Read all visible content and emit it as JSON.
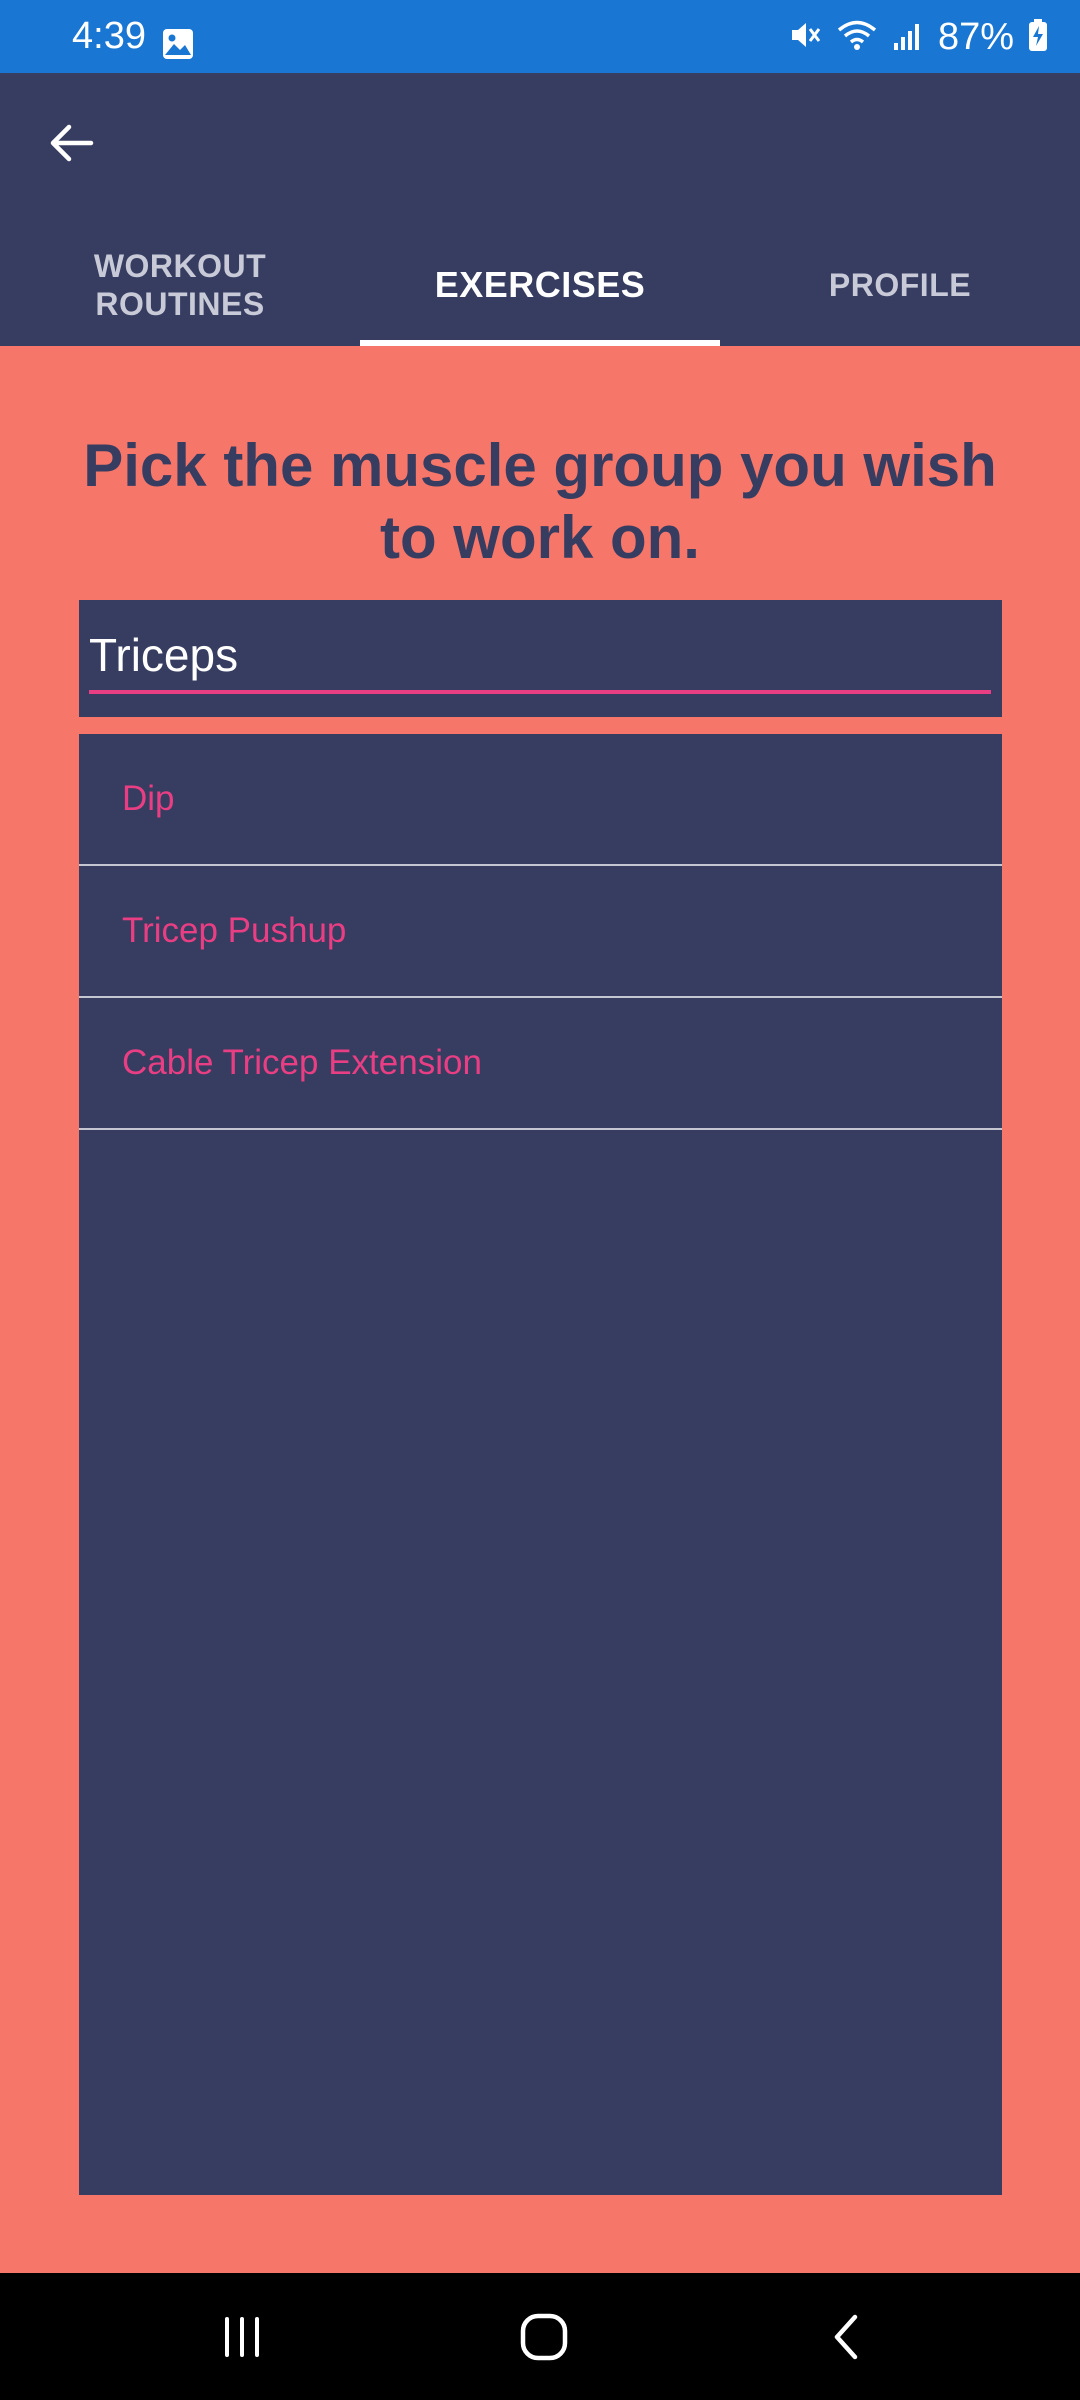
{
  "status_bar": {
    "time": "4:39",
    "battery_percent": "87%",
    "icons": [
      "image-icon",
      "mute-icon",
      "wifi-icon",
      "signal-icon",
      "battery-charging-icon"
    ]
  },
  "header": {
    "back_icon": "arrow-left-icon"
  },
  "tabs": [
    {
      "label": "WORKOUT ROUTINES",
      "active": false
    },
    {
      "label": "EXERCISES",
      "active": true
    },
    {
      "label": "PROFILE",
      "active": false
    }
  ],
  "main": {
    "heading": "Pick the muscle group you wish to work on.",
    "search_value": "Triceps",
    "results": [
      {
        "label": "Dip"
      },
      {
        "label": "Tricep Pushup"
      },
      {
        "label": "Cable Tricep Extension"
      }
    ]
  },
  "nav_bar": {
    "icons": [
      "recent-apps-icon",
      "home-icon",
      "back-icon"
    ]
  },
  "colors": {
    "status_bar": "#1976d2",
    "header": "#363d60",
    "background": "#f6766a",
    "accent": "#e93e83"
  }
}
